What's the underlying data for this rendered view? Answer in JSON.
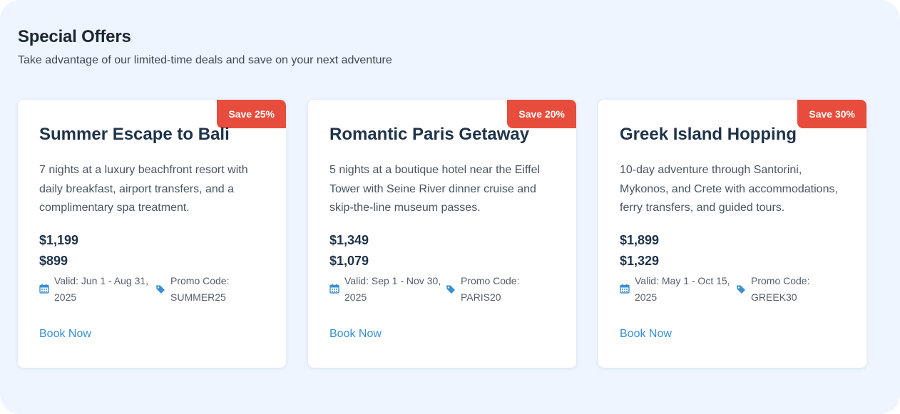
{
  "section": {
    "title": "Special Offers",
    "subtitle": "Take advantage of our limited-time deals and save on your next adventure"
  },
  "offers": [
    {
      "badge": "Save 25%",
      "title": "Summer Escape to Bali",
      "description": "7 nights at a luxury beachfront resort with daily breakfast, airport transfers, and a complimentary spa treatment.",
      "original_price": "$1,199",
      "sale_price": "$899",
      "valid": "Valid: Jun 1 - Aug 31, 2025",
      "promo": "Promo Code: SUMMER25",
      "cta": "Book Now"
    },
    {
      "badge": "Save 20%",
      "title": "Romantic Paris Getaway",
      "description": "5 nights at a boutique hotel near the Eiffel Tower with Seine River dinner cruise and skip-the-line museum passes.",
      "original_price": "$1,349",
      "sale_price": "$1,079",
      "valid": "Valid: Sep 1 - Nov 30, 2025",
      "promo": "Promo Code: PARIS20",
      "cta": "Book Now"
    },
    {
      "badge": "Save 30%",
      "title": "Greek Island Hopping",
      "description": "10-day adventure through Santorini, Mykonos, and Crete with accommodations, ferry transfers, and guided tours.",
      "original_price": "$1,899",
      "sale_price": "$1,329",
      "valid": "Valid: May 1 - Oct 15, 2025",
      "promo": "Promo Code: GREEK30",
      "cta": "Book Now"
    }
  ],
  "icons": {
    "calendar": "calendar-icon",
    "tag": "tag-icon"
  },
  "colors": {
    "background": "#eef5fe",
    "badge": "#e74c3c",
    "heading": "#1f3349",
    "link": "#3a8fd0",
    "icon": "#3a8fd0"
  }
}
